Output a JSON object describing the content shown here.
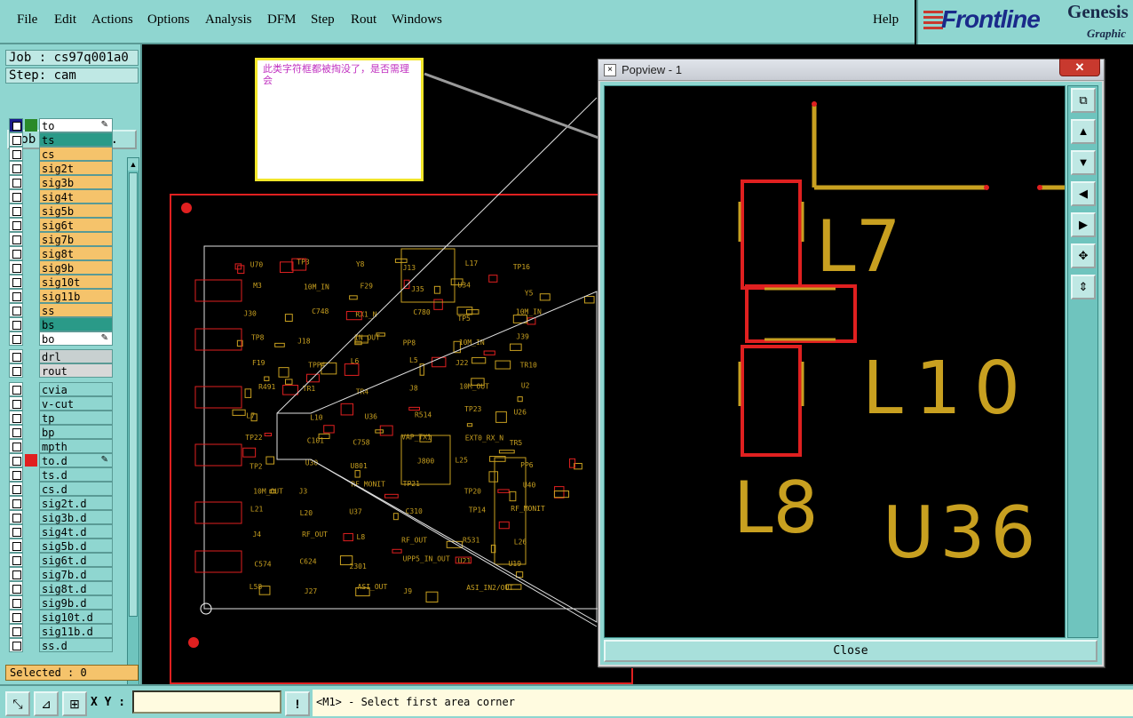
{
  "menu": {
    "items": [
      "File",
      "Edit",
      "Actions",
      "Options",
      "Analysis",
      "DFM",
      "Step",
      "Rout",
      "Windows"
    ],
    "help": "Help"
  },
  "logo": {
    "brand": "Frontline",
    "product": "Genesis",
    "tagline": "Graphic"
  },
  "job": {
    "job_label": "Job : cs97q001a0",
    "step_label": "Step: cam",
    "matrix_button": "Job Matrix ..."
  },
  "layers_group1": [
    {
      "name": "to",
      "color": "#ffffff",
      "swatch": "#2a8a2a",
      "edit": true,
      "active": true
    },
    {
      "name": "ts",
      "color": "#2a9a88",
      "swatch": "",
      "edit": false
    },
    {
      "name": "cs",
      "color": "#f5c36b",
      "swatch": "",
      "edit": false
    },
    {
      "name": "sig2t",
      "color": "#f5c36b",
      "swatch": "",
      "edit": false
    },
    {
      "name": "sig3b",
      "color": "#f5c36b",
      "swatch": "",
      "edit": false
    },
    {
      "name": "sig4t",
      "color": "#f5c36b",
      "swatch": "",
      "edit": false
    },
    {
      "name": "sig5b",
      "color": "#f5c36b",
      "swatch": "",
      "edit": false
    },
    {
      "name": "sig6t",
      "color": "#f5c36b",
      "swatch": "",
      "edit": false
    },
    {
      "name": "sig7b",
      "color": "#f5c36b",
      "swatch": "",
      "edit": false
    },
    {
      "name": "sig8t",
      "color": "#f5c36b",
      "swatch": "",
      "edit": false
    },
    {
      "name": "sig9b",
      "color": "#f5c36b",
      "swatch": "",
      "edit": false
    },
    {
      "name": "sig10t",
      "color": "#f5c36b",
      "swatch": "",
      "edit": false
    },
    {
      "name": "sig11b",
      "color": "#f5c36b",
      "swatch": "",
      "edit": false
    },
    {
      "name": "ss",
      "color": "#f5c36b",
      "swatch": "",
      "edit": false
    },
    {
      "name": "bs",
      "color": "#2a9a88",
      "swatch": "",
      "edit": false
    },
    {
      "name": "bo",
      "color": "#ffffff",
      "swatch": "",
      "edit": true
    }
  ],
  "layers_group2": [
    {
      "name": "drl",
      "color": "#c8d0d0"
    },
    {
      "name": "rout",
      "color": "#d8d8d8"
    }
  ],
  "layers_group3": [
    {
      "name": "cvia",
      "color": "#8fd6d0",
      "swatch": "",
      "edit": false
    },
    {
      "name": "v-cut",
      "color": "#8fd6d0",
      "swatch": "",
      "edit": false
    },
    {
      "name": "tp",
      "color": "#8fd6d0",
      "swatch": "",
      "edit": false
    },
    {
      "name": "bp",
      "color": "#8fd6d0",
      "swatch": "",
      "edit": false
    },
    {
      "name": "mpth",
      "color": "#8fd6d0",
      "swatch": "",
      "edit": false
    },
    {
      "name": "to.d",
      "color": "#8fd6d0",
      "swatch": "#e02020",
      "edit": true
    },
    {
      "name": "ts.d",
      "color": "#8fd6d0",
      "swatch": "",
      "edit": false
    },
    {
      "name": "cs.d",
      "color": "#8fd6d0",
      "swatch": "",
      "edit": false
    },
    {
      "name": "sig2t.d",
      "color": "#8fd6d0",
      "swatch": "",
      "edit": false
    },
    {
      "name": "sig3b.d",
      "color": "#8fd6d0",
      "swatch": "",
      "edit": false
    },
    {
      "name": "sig4t.d",
      "color": "#8fd6d0",
      "swatch": "",
      "edit": false
    },
    {
      "name": "sig5b.d",
      "color": "#8fd6d0",
      "swatch": "",
      "edit": false
    },
    {
      "name": "sig6t.d",
      "color": "#8fd6d0",
      "swatch": "",
      "edit": false
    },
    {
      "name": "sig7b.d",
      "color": "#8fd6d0",
      "swatch": "",
      "edit": false
    },
    {
      "name": "sig8t.d",
      "color": "#8fd6d0",
      "swatch": "",
      "edit": false
    },
    {
      "name": "sig9b.d",
      "color": "#8fd6d0",
      "swatch": "",
      "edit": false
    },
    {
      "name": "sig10t.d",
      "color": "#8fd6d0",
      "swatch": "",
      "edit": false
    },
    {
      "name": "sig11b.d",
      "color": "#8fd6d0",
      "swatch": "",
      "edit": false
    },
    {
      "name": "ss.d",
      "color": "#8fd6d0",
      "swatch": "",
      "edit": false
    }
  ],
  "selected_label": "Selected : 0",
  "status": {
    "xy_label": "X Y :",
    "xy_value": "",
    "message": "<M1> - Select first area corner",
    "info_button": "!"
  },
  "note": {
    "text": "此类字符框都被掏没了，是否需理会"
  },
  "popview": {
    "title": "Popview - 1",
    "close_button": "Close",
    "labels": [
      "L7",
      "L10",
      "L8",
      "U36"
    ],
    "tools": [
      "zoom-home-icon",
      "pan-up-icon",
      "pan-down-icon",
      "pan-left-icon",
      "pan-right-icon",
      "zoom-in-icon",
      "zoom-out-icon"
    ]
  },
  "board": {
    "refdes": [
      "U70",
      "TP3",
      "Y8",
      "J13",
      "L17",
      "TP16",
      "M3",
      "10M_IN",
      "F29",
      "J35",
      "U34",
      "Y5",
      "J30",
      "C748",
      "RX1_N",
      "C780",
      "TP5",
      "10M_IN",
      "TP8",
      "J18",
      "IN_OUT",
      "PP8",
      "10M_IN",
      "J39",
      "F19",
      "TPP4",
      "L6",
      "L5",
      "J22",
      "TR10",
      "R491",
      "TR1",
      "TR4",
      "J8",
      "10M_OUT",
      "U2",
      "L7",
      "L10",
      "U36",
      "R514",
      "TP23",
      "U26",
      "TP22",
      "C101",
      "C758",
      "VAP_TX1",
      "EXT0_RX_N",
      "TR5",
      "TP2",
      "U30",
      "U801",
      "J800",
      "L25",
      "PP6",
      "10M_OUT",
      "J3",
      "RF_MONIT",
      "TP21",
      "TP20",
      "U40",
      "L21",
      "L20",
      "U37",
      "C310",
      "TP14",
      "RF_MONIT",
      "J4",
      "RF_OUT",
      "L8",
      "RF_OUT",
      "R531",
      "L26",
      "C574",
      "C624",
      "2301",
      "UPP5_IN_OUT",
      "U21",
      "U19",
      "L58",
      "J27",
      "ASI_OUT",
      "J9",
      "ASI_IN2/OUT"
    ]
  }
}
